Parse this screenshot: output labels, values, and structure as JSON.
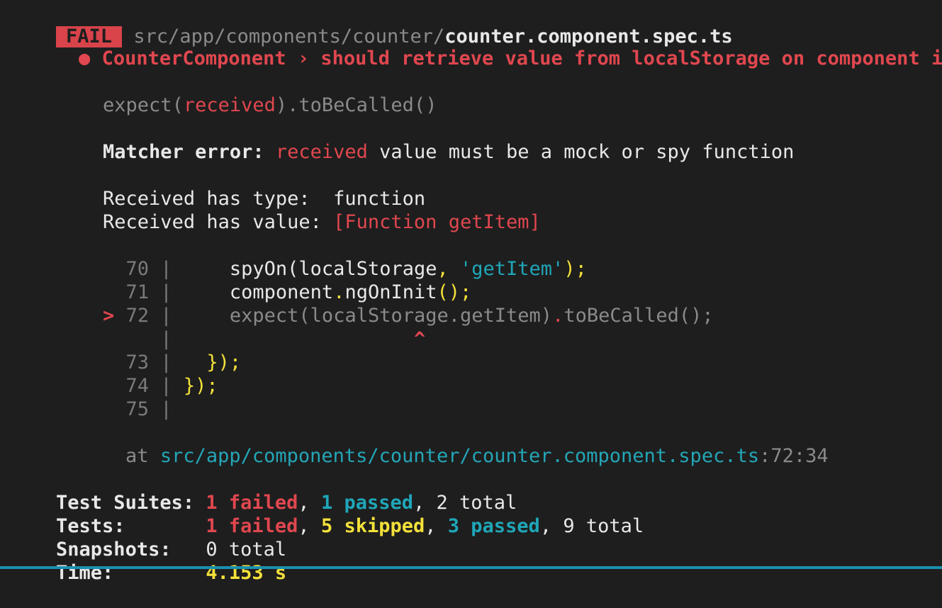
{
  "header": {
    "badge": "FAIL",
    "path_dir": "src/app/components/counter/",
    "path_file": "counter.component.spec.ts"
  },
  "test": {
    "bullet": "●",
    "title": "CounterComponent › should retrieve value from localStorage on component init"
  },
  "error": {
    "expect_prefix": "expect(",
    "expect_received": "received",
    "expect_suffix": ").toBeCalled()",
    "matcher_label": "Matcher error:",
    "matcher_received": "received",
    "matcher_message": " value must be a mock or spy function",
    "type_label": "Received has type:  ",
    "type_value": "function",
    "value_label": "Received has value: ",
    "value_value": "[Function getItem]"
  },
  "code": {
    "pointer": ">",
    "line70_num": "70",
    "line70_a": "spyOn(localStorage",
    "line70_comma": ",",
    "line70_str": "'getItem'",
    "line70_end": ");",
    "line71_num": "71",
    "line71_a": "component",
    "line71_dot": ".",
    "line71_b": "ngOnInit",
    "line71_c": "();",
    "line72_num": "72",
    "line72_a": "expect(localStorage",
    "line72_dot": ".",
    "line72_b": "getItem)",
    "line72_dot2": ".",
    "line72_c": "toBeCalled();",
    "caret": "^",
    "line73_num": "73",
    "line73_a": "});",
    "line74_num": "74",
    "line74_a": "});",
    "line75_num": "75",
    "pipe": "|"
  },
  "location": {
    "at": "at ",
    "path": "src/app/components/counter/counter.component.spec.ts",
    "pos": ":72:34"
  },
  "summary": {
    "suites_label": "Test Suites:",
    "suites_failed": "1 failed",
    "suites_passed": "1 passed",
    "suites_total": "2 total",
    "tests_label": "Tests:",
    "tests_failed": "1 failed",
    "tests_skipped": "5 skipped",
    "tests_passed": "3 passed",
    "tests_total": "9 total",
    "snapshots_label": "Snapshots:",
    "snapshots_value": "0 total",
    "time_label": "Time:",
    "time_value": "4.153 s"
  },
  "colors": {
    "background": "#1e1e1e",
    "fail": "#d9434a",
    "passed": "#1fa6b8",
    "skipped": "#f3e13a"
  }
}
